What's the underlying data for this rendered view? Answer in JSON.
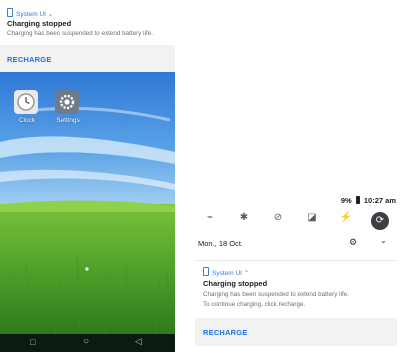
{
  "left": {
    "notification": {
      "app_name": "System UI",
      "title": "Charging stopped",
      "body": "Charging has been suspended to extend battery life.",
      "action": "RECHARGE"
    },
    "home_apps": [
      {
        "label": "Clock",
        "icon": "clock-icon"
      },
      {
        "label": "Settings",
        "icon": "gear-icon"
      }
    ],
    "nav": {
      "back": "◁",
      "home": "○",
      "recents": "□"
    }
  },
  "right": {
    "status": {
      "battery": "9%",
      "time": "10:27 am"
    },
    "quick_settings": [
      {
        "icon": "wifi-off-icon",
        "glyph": "⌁"
      },
      {
        "icon": "bluetooth-icon",
        "glyph": "✱"
      },
      {
        "icon": "dnd-icon",
        "glyph": "⊘"
      },
      {
        "icon": "mobile-data-off-icon",
        "glyph": "◪"
      },
      {
        "icon": "flashlight-off-icon",
        "glyph": "⚡"
      },
      {
        "icon": "auto-rotate-icon",
        "glyph": "⟳"
      }
    ],
    "date": "Mon., 18 Oct.",
    "notification": {
      "app_name": "System UI",
      "title": "Charging stopped",
      "body_line1": "Charging has been suspended to extend battery life.",
      "body_line2": "To continue charging, click recharge.",
      "action": "RECHARGE"
    }
  }
}
